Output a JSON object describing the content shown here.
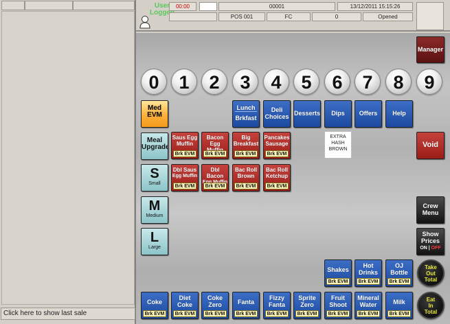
{
  "status_bar": {
    "user_line1": "User",
    "user_line2": "Logged",
    "timer": "00:00",
    "order_number": "00001",
    "datetime": "13/12/2011 15:15:26",
    "pos": "POS 001",
    "mode": "FC",
    "count": "0",
    "state": "Opened",
    "timer_color": "#cc0000"
  },
  "left_panel": {
    "last_sale_label": "Click here to show last sale"
  },
  "numpad": [
    "0",
    "1",
    "2",
    "3",
    "4",
    "5",
    "6",
    "7",
    "8",
    "9"
  ],
  "top_nav": {
    "lunch": "Lunch",
    "brkfast": "Brkfast",
    "deli_1": "Deli",
    "deli_2": "Choices",
    "desserts": "Desserts",
    "dips": "Dips",
    "offers": "Offers",
    "help": "Help"
  },
  "side_left": {
    "med_evm_1": "Med",
    "med_evm_2": "EVM",
    "meal_upgrade_1": "Meal",
    "meal_upgrade_2": "Upgrade",
    "small_big": "S",
    "small_sub": "Small",
    "medium_big": "M",
    "medium_sub": "Medium",
    "large_big": "L",
    "large_sub": "Large"
  },
  "breakfast_items": [
    {
      "l1": "Saus Egg",
      "l2": "Muffin",
      "tag": "Brk EVM"
    },
    {
      "l1": "Bacon Egg",
      "l2": "Muffin",
      "tag": "Brk EVM"
    },
    {
      "l1": "Big",
      "l2": "Breakfast",
      "tag": "Brk EVM"
    },
    {
      "l1": "Pancakes",
      "l2": "Sausage",
      "tag": "Brk EVM"
    },
    {
      "l1": "Dbl Saus",
      "l2": "Egg Muffin",
      "tag": "Brk EVM"
    },
    {
      "l1": "Dbl Bacon",
      "l2": "Egg Muffin",
      "tag": "Brk EVM"
    },
    {
      "l1": "Bac Roll",
      "l2": "Brown",
      "tag": "Brk EVM"
    },
    {
      "l1": "Bac Roll",
      "l2": "Ketchup",
      "tag": "Brk EVM"
    }
  ],
  "extra_hash": {
    "l1": "EXTRA",
    "l2": "HASH",
    "l3": "BROWN"
  },
  "right_side": {
    "manager": "Manager",
    "void": "Void",
    "crew_1": "Crew",
    "crew_2": "Menu",
    "show_1": "Show",
    "show_2": "Prices",
    "on": "ON",
    "sep": " | ",
    "off": "OFF",
    "take_1": "Take",
    "take_2": "Out",
    "take_3": "Total",
    "eat_1": "Eat",
    "eat_2": "In",
    "eat_3": "Total"
  },
  "drinks_top": [
    {
      "l1": "Shakes",
      "l2": "",
      "tag": "Brk EVM"
    },
    {
      "l1": "Hot",
      "l2": "Drinks",
      "tag": "Brk EVM"
    },
    {
      "l1": "OJ",
      "l2": "Bottle",
      "tag": "Brk EVM"
    }
  ],
  "drinks_bottom": [
    {
      "l1": "Coke",
      "l2": "",
      "tag": "Brk EVM"
    },
    {
      "l1": "Diet",
      "l2": "Coke",
      "tag": "Brk EVM"
    },
    {
      "l1": "Coke",
      "l2": "Zero",
      "tag": "Brk EVM"
    },
    {
      "l1": "Fanta",
      "l2": "",
      "tag": "Brk EVM"
    },
    {
      "l1": "Fizzy",
      "l2": "Fanta",
      "tag": "Brk EVM"
    },
    {
      "l1": "Sprite",
      "l2": "Zero",
      "tag": "Brk EVM"
    },
    {
      "l1": "Fruit",
      "l2": "Shoot",
      "tag": "Brk EVM"
    },
    {
      "l1": "Mineral",
      "l2": "Water",
      "tag": "Brk EVM"
    },
    {
      "l1": "Milk",
      "l2": "",
      "tag": "Brk EVM"
    }
  ],
  "colors": {
    "button_blue": "#1b4aa0",
    "button_red": "#9a1c18",
    "total_text": "#e8e83a"
  }
}
